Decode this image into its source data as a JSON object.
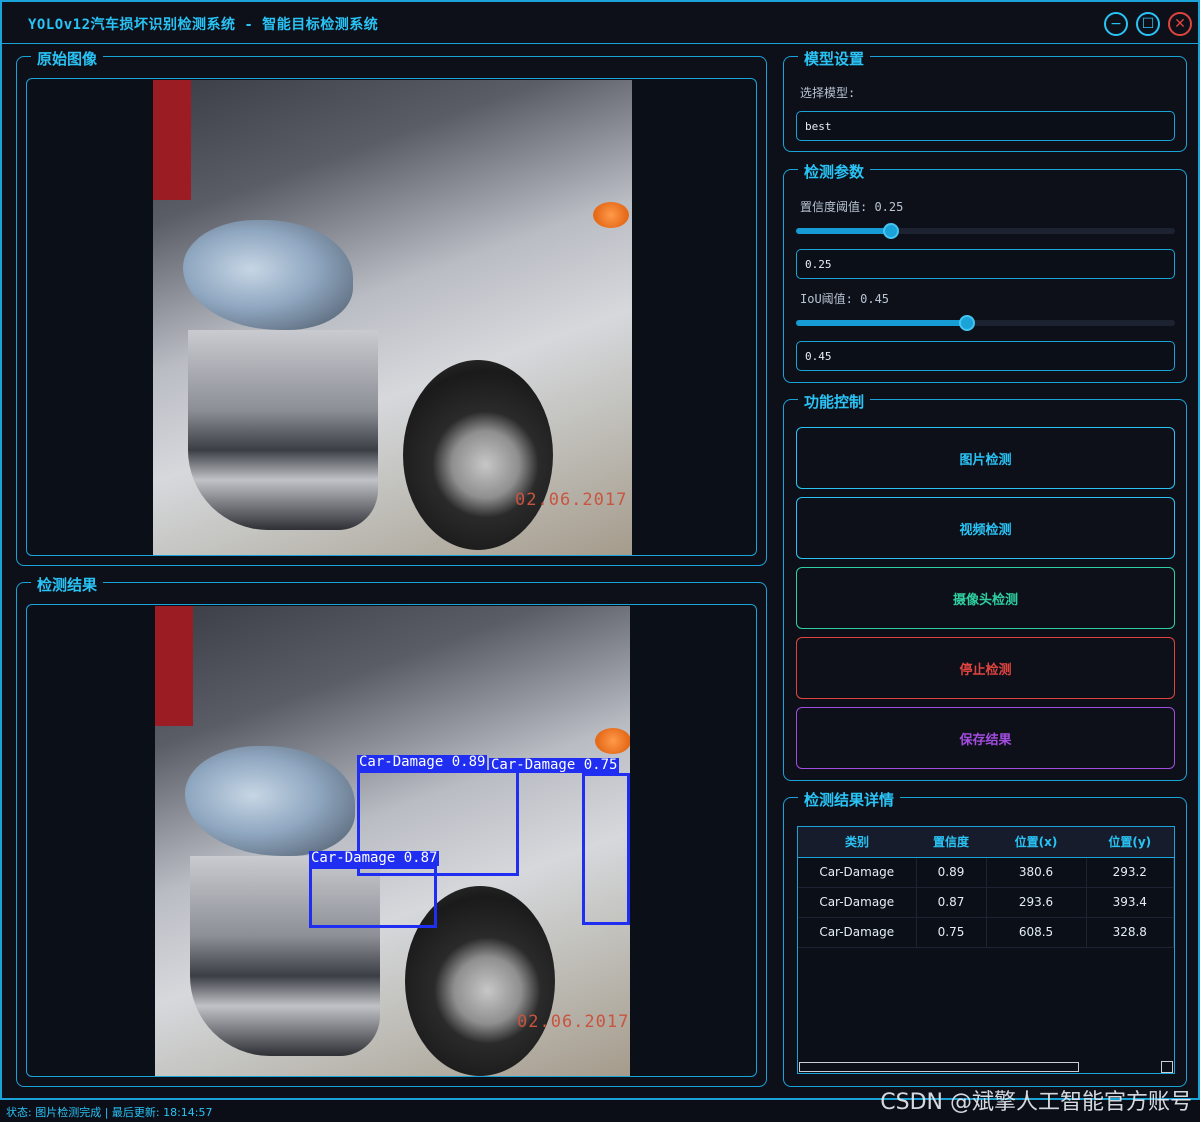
{
  "window": {
    "title": "YOLOv12汽车损坏识别检测系统 - 智能目标检测系统",
    "minimize_glyph": "−",
    "maximize_glyph": "☐",
    "close_glyph": "✕"
  },
  "original_panel": {
    "title": "原始图像",
    "date_stamp": "02.06.2017"
  },
  "result_panel": {
    "title": "检测结果",
    "date_stamp": "02.06.2017",
    "detections": [
      {
        "label": "Car-Damage 0.89"
      },
      {
        "label": "Car-Damage 0.75"
      },
      {
        "label": "Car-Damage 0.87"
      }
    ]
  },
  "model_settings": {
    "title": "模型设置",
    "select_label": "选择模型:",
    "model_value": "best"
  },
  "detection_params": {
    "title": "检测参数",
    "confidence_label": "置信度阈值: 0.25",
    "confidence_value": "0.25",
    "confidence_fraction": 0.25,
    "iou_label": "IoU阈值: 0.45",
    "iou_value": "0.45",
    "iou_fraction": 0.45
  },
  "function_control": {
    "title": "功能控制",
    "buttons": [
      {
        "label": "图片检测",
        "color": "#29c3f5"
      },
      {
        "label": "视频检测",
        "color": "#29c3f5"
      },
      {
        "label": "摄像头检测",
        "color": "#2fd0a0"
      },
      {
        "label": "停止检测",
        "color": "#e0443f"
      },
      {
        "label": "保存结果",
        "color": "#a24de0"
      }
    ]
  },
  "results_detail": {
    "title": "检测结果详情",
    "columns": [
      "类别",
      "置信度",
      "位置(x)",
      "位置(y)"
    ],
    "rows": [
      [
        "Car-Damage",
        "0.89",
        "380.6",
        "293.2"
      ],
      [
        "Car-Damage",
        "0.87",
        "293.6",
        "393.4"
      ],
      [
        "Car-Damage",
        "0.75",
        "608.5",
        "328.8"
      ]
    ]
  },
  "status_bar": {
    "text": "状态: 图片检测完成 | 最后更新: 18:14:57",
    "watermark": "CSDN @斌擎人工智能官方账号"
  }
}
